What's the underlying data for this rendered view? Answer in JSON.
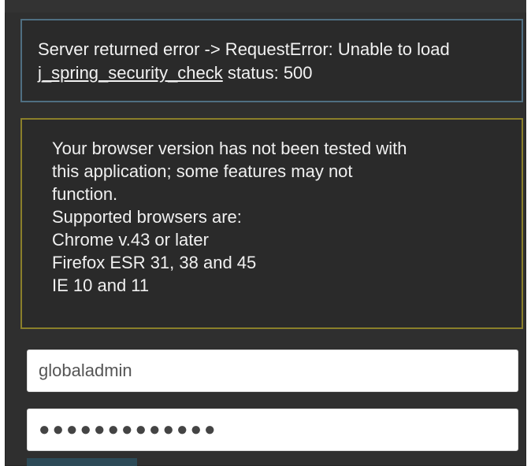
{
  "error_message": {
    "prefix": "Server returned error -> RequestError: Unable to load ",
    "link": "j_spring_security_check",
    "suffix": " status: 500"
  },
  "browser_warning": {
    "lines": [
      "Your browser version has not been tested with",
      "this application; some features may not",
      "function.",
      "Supported browsers are:",
      "Chrome v.43 or later",
      "Firefox ESR 31, 38 and 45",
      "IE 10 and 11"
    ]
  },
  "login_form": {
    "username_value": "globaladmin",
    "password_value": "●●●●●●●●●●●●●"
  }
}
